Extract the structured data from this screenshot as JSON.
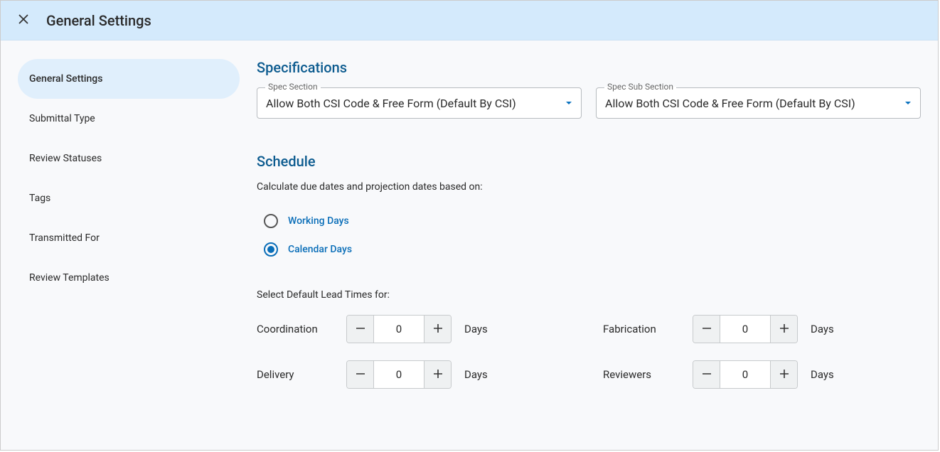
{
  "header": {
    "title": "General Settings"
  },
  "sidebar": {
    "items": [
      {
        "label": "General Settings",
        "active": true
      },
      {
        "label": "Submittal Type",
        "active": false
      },
      {
        "label": "Review Statuses",
        "active": false
      },
      {
        "label": "Tags",
        "active": false
      },
      {
        "label": "Transmitted For",
        "active": false
      },
      {
        "label": "Review Templates",
        "active": false
      }
    ]
  },
  "specifications": {
    "heading": "Specifications",
    "spec_section": {
      "label": "Spec Section",
      "value": "Allow Both CSI Code & Free Form (Default By CSI)"
    },
    "spec_sub_section": {
      "label": "Spec Sub Section",
      "value": "Allow Both CSI Code & Free Form (Default By CSI)"
    }
  },
  "schedule": {
    "heading": "Schedule",
    "calc_label": "Calculate due dates and projection dates based on:",
    "radio_options": [
      {
        "label": "Working Days",
        "selected": false
      },
      {
        "label": "Calendar Days",
        "selected": true
      }
    ],
    "lead_times_label": "Select Default Lead Times for:",
    "unit_label": "Days",
    "lead_times": {
      "coordination": {
        "label": "Coordination",
        "value": "0"
      },
      "fabrication": {
        "label": "Fabrication",
        "value": "0"
      },
      "delivery": {
        "label": "Delivery",
        "value": "0"
      },
      "reviewers": {
        "label": "Reviewers",
        "value": "0"
      }
    }
  }
}
